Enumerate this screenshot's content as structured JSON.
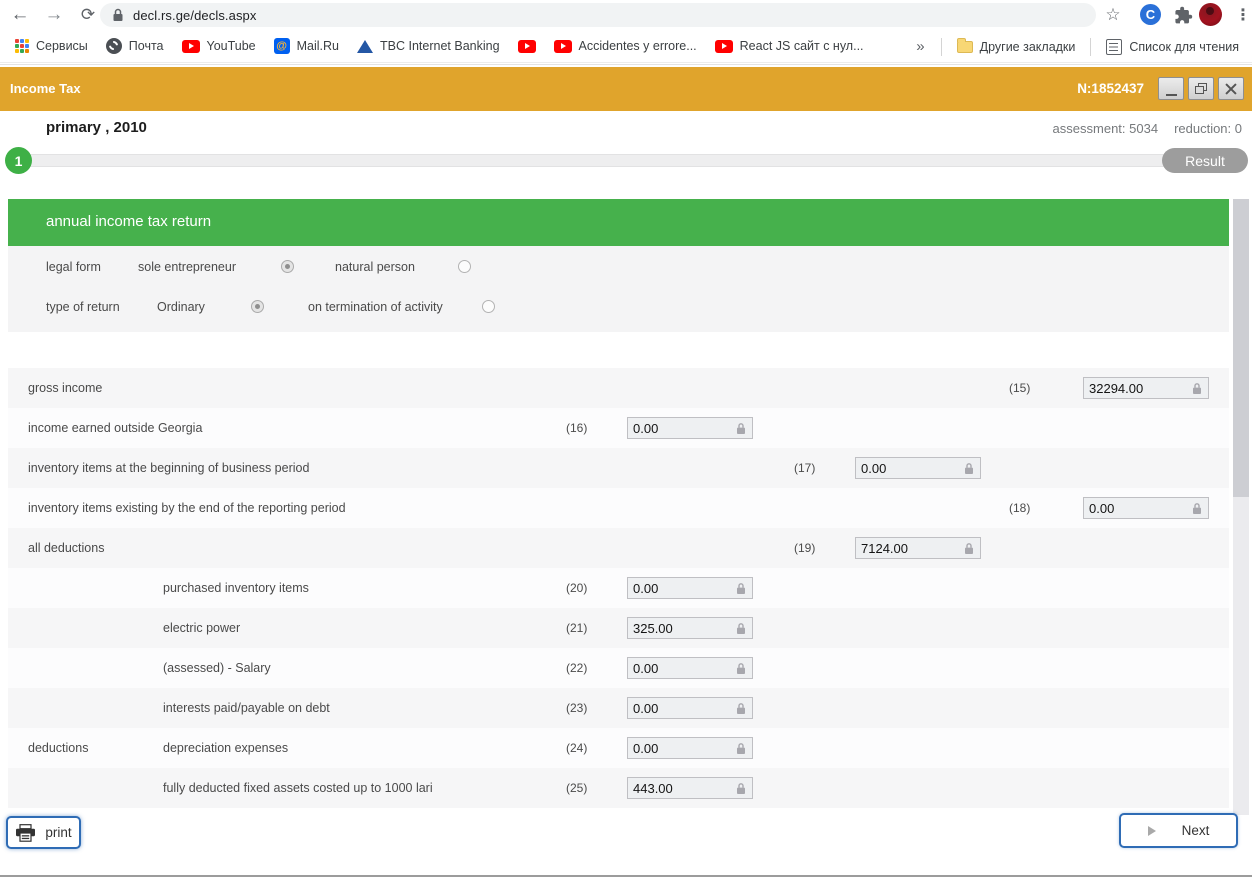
{
  "browser": {
    "url": "decl.rs.ge/decls.aspx",
    "bookmarks": [
      {
        "label": "Сервисы",
        "icon": "apps-grid"
      },
      {
        "label": "Почта",
        "icon": "globe"
      },
      {
        "label": "YouTube",
        "icon": "youtube"
      },
      {
        "label": "Mail.Ru",
        "icon": "mailru"
      },
      {
        "label": "TBC Internet Banking",
        "icon": "tbc"
      },
      {
        "label": "",
        "icon": "youtube"
      },
      {
        "label": "Accidentes y errore...",
        "icon": "youtube"
      },
      {
        "label": "React JS сайт с нул...",
        "icon": "youtube"
      }
    ],
    "overflow_chevron": "»",
    "other_bookmarks_label": "Другие закладки",
    "reading_list_label": "Список для чтения"
  },
  "titlebar": {
    "title": "Income Tax",
    "doc_number": "N:1852437"
  },
  "subheader": {
    "period": "primary , 2010",
    "assessment": "assessment: 5034",
    "reduction": "reduction: 0"
  },
  "stepper": {
    "step": "1",
    "result_label": "Result"
  },
  "form": {
    "section_title": "annual income tax return",
    "radio_rows": [
      {
        "label": "legal form",
        "options": [
          {
            "label": "sole entrepreneur",
            "checked": true
          },
          {
            "label": "natural person",
            "checked": false
          }
        ]
      },
      {
        "label": "type of return",
        "options": [
          {
            "label": "Ordinary",
            "checked": true
          },
          {
            "label": "on termination of activity",
            "checked": false
          }
        ]
      }
    ],
    "rows": [
      {
        "group": "",
        "label": "gross income",
        "indent": false,
        "num": "(15)",
        "value": "32294.00",
        "col": "right"
      },
      {
        "group": "",
        "label": "income earned outside Georgia",
        "indent": false,
        "num": "(16)",
        "value": "0.00",
        "col": "left"
      },
      {
        "group": "",
        "label": "inventory items at the beginning of business period",
        "indent": false,
        "num": "(17)",
        "value": "0.00",
        "col": "mid"
      },
      {
        "group": "",
        "label": "inventory items existing by the end of the reporting period",
        "indent": false,
        "num": "(18)",
        "value": "0.00",
        "col": "right"
      },
      {
        "group": "",
        "label": "all deductions",
        "indent": false,
        "num": "(19)",
        "value": "7124.00",
        "col": "mid"
      },
      {
        "group": "",
        "label": "purchased inventory items",
        "indent": true,
        "num": "(20)",
        "value": "0.00",
        "col": "left"
      },
      {
        "group": "",
        "label": "electric power",
        "indent": true,
        "num": "(21)",
        "value": "325.00",
        "col": "left"
      },
      {
        "group": "",
        "label": "(assessed) - Salary",
        "indent": true,
        "num": "(22)",
        "value": "0.00",
        "col": "left"
      },
      {
        "group": "",
        "label": "interests paid/payable on debt",
        "indent": true,
        "num": "(23)",
        "value": "0.00",
        "col": "left"
      },
      {
        "group": "deductions",
        "label": "depreciation expenses",
        "indent": true,
        "num": "(24)",
        "value": "0.00",
        "col": "left"
      },
      {
        "group": "",
        "label": "fully deducted fixed assets costed up to 1000 lari",
        "indent": true,
        "num": "(25)",
        "value": "443.00",
        "col": "left"
      }
    ]
  },
  "footer": {
    "print_label": "print",
    "next_label": "Next"
  },
  "colors": {
    "titlebar_gold": "#e0a42c",
    "section_green": "#46b14c",
    "step_green": "#3eb046",
    "result_gray": "#9d9d9d",
    "button_border_blue": "#2f6cb5",
    "field_bg": "#eef0f2"
  }
}
